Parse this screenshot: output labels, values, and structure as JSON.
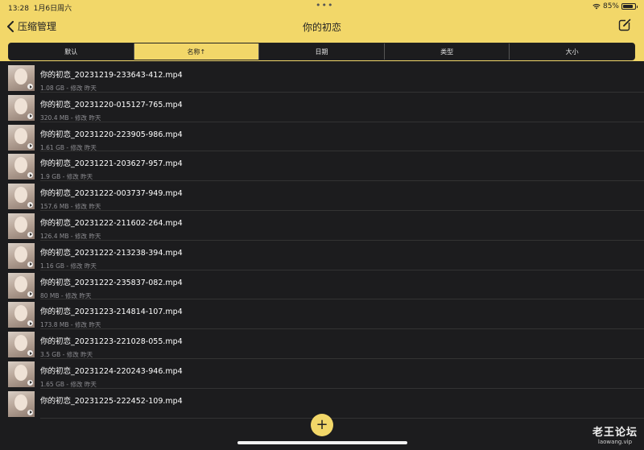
{
  "status_bar": {
    "time": "13:28",
    "date": "1月6日周六",
    "dots": "•••",
    "battery": "85%",
    "battery_level": 0.85
  },
  "nav": {
    "back_label": "压缩管理",
    "title": "你的初恋",
    "compose_icon": "compose-icon"
  },
  "sort_tabs": [
    {
      "label": "默认",
      "active": false
    },
    {
      "label": "名称↑",
      "active": true
    },
    {
      "label": "日期",
      "active": false
    },
    {
      "label": "类型",
      "active": false
    },
    {
      "label": "大小",
      "active": false
    }
  ],
  "files": [
    {
      "name": "你的初恋_20231219-233643-412.mp4",
      "meta": "1.08 GB - 修改 昨天"
    },
    {
      "name": "你的初恋_20231220-015127-765.mp4",
      "meta": "320.4 MB - 修改 昨天"
    },
    {
      "name": "你的初恋_20231220-223905-986.mp4",
      "meta": "1.61 GB - 修改 昨天"
    },
    {
      "name": "你的初恋_20231221-203627-957.mp4",
      "meta": "1.9 GB - 修改 昨天"
    },
    {
      "name": "你的初恋_20231222-003737-949.mp4",
      "meta": "157.6 MB - 修改 昨天"
    },
    {
      "name": "你的初恋_20231222-211602-264.mp4",
      "meta": "126.4 MB - 修改 昨天"
    },
    {
      "name": "你的初恋_20231222-213238-394.mp4",
      "meta": "1.16 GB - 修改 昨天"
    },
    {
      "name": "你的初恋_20231222-235837-082.mp4",
      "meta": "80 MB - 修改 昨天"
    },
    {
      "name": "你的初恋_20231223-214814-107.mp4",
      "meta": "173.8 MB - 修改 昨天"
    },
    {
      "name": "你的初恋_20231223-221028-055.mp4",
      "meta": "3.5 GB - 修改 昨天"
    },
    {
      "name": "你的初恋_20231224-220243-946.mp4",
      "meta": "1.65 GB - 修改 昨天"
    },
    {
      "name": "你的初恋_20231225-222452-109.mp4",
      "meta": ""
    }
  ],
  "add_button_label": "+",
  "watermark": {
    "title": "老王论坛",
    "url": "laowang.vip"
  },
  "colors": {
    "accent": "#f2d769",
    "background": "#1c1c1e",
    "secondary_text": "#8e8e93"
  }
}
